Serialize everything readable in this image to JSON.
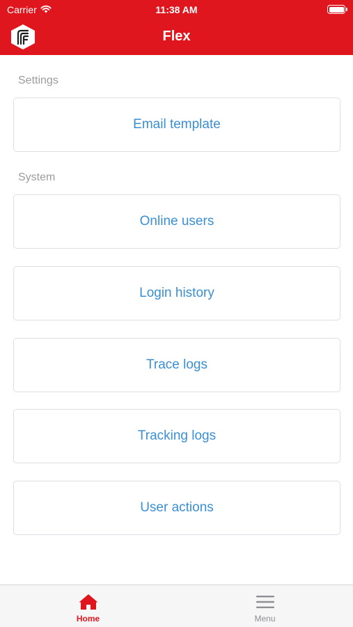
{
  "status_bar": {
    "carrier": "Carrier",
    "time": "11:38 AM",
    "wifi_icon": "wifi-icon",
    "battery_icon": "battery-icon"
  },
  "header": {
    "title": "Flex",
    "logo": "flex-logo",
    "background_color": "#e0161f"
  },
  "sections": [
    {
      "label": "Settings",
      "items": [
        {
          "label": "Email template"
        }
      ]
    },
    {
      "label": "System",
      "items": [
        {
          "label": "Online users"
        },
        {
          "label": "Login history"
        },
        {
          "label": "Trace logs"
        },
        {
          "label": "Tracking logs"
        },
        {
          "label": "User actions"
        }
      ]
    }
  ],
  "tabbar": {
    "tabs": [
      {
        "label": "Home",
        "icon": "home-icon",
        "active": true
      },
      {
        "label": "Menu",
        "icon": "menu-icon",
        "active": false
      }
    ],
    "active_color": "#e0161f"
  },
  "colors": {
    "link": "#3a8fd3",
    "section_label": "#9b9b9b"
  }
}
